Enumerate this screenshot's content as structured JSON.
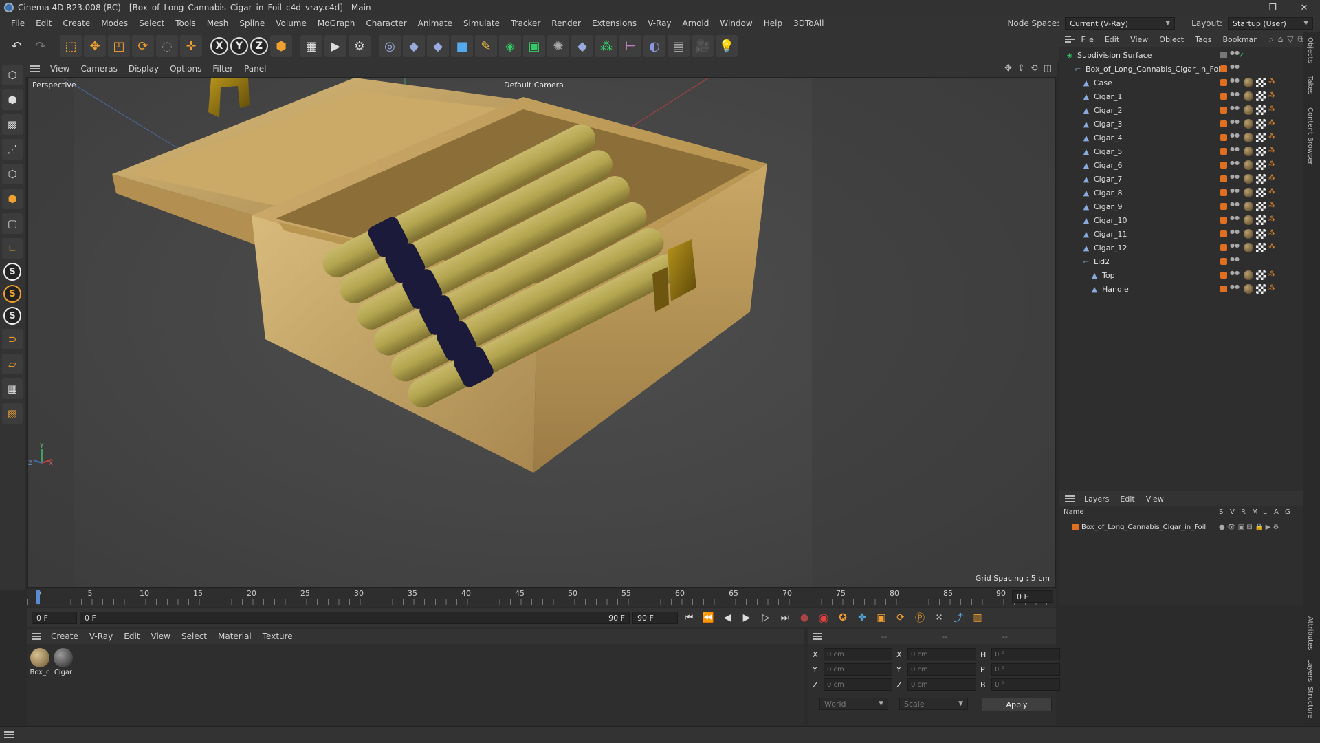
{
  "window": {
    "title": "Cinema 4D R23.008 (RC) - [Box_of_Long_Cannabis_Cigar_in_Foil_c4d_vray.c4d] - Main"
  },
  "menubar": {
    "items": [
      "File",
      "Edit",
      "Create",
      "Modes",
      "Select",
      "Tools",
      "Mesh",
      "Spline",
      "Volume",
      "MoGraph",
      "Character",
      "Animate",
      "Simulate",
      "Tracker",
      "Render",
      "Extensions",
      "V-Ray",
      "Arnold",
      "Window",
      "Help",
      "3DToAll"
    ],
    "node_space_label": "Node Space:",
    "node_space_value": "Current (V-Ray)",
    "layout_label": "Layout:",
    "layout_value": "Startup (User)"
  },
  "viewport": {
    "menu": [
      "View",
      "Cameras",
      "Display",
      "Options",
      "Filter",
      "Panel"
    ],
    "label": "Perspective",
    "camera": "Default Camera",
    "grid_spacing": "Grid Spacing : 5 cm"
  },
  "timeline": {
    "ticks": [
      "0",
      "5",
      "10",
      "15",
      "20",
      "25",
      "30",
      "35",
      "40",
      "45",
      "50",
      "55",
      "60",
      "65",
      "70",
      "75",
      "80",
      "85",
      "90"
    ],
    "current_frame": "0 F",
    "end_field": "0 F",
    "start": "0 F",
    "range_start": "0 F",
    "range_end": "90 F",
    "max_frame": "90 F"
  },
  "material_manager": {
    "menu": [
      "Create",
      "V-Ray",
      "Edit",
      "View",
      "Select",
      "Material",
      "Texture"
    ],
    "materials": [
      {
        "label": "Box_c",
        "color": "#a08858"
      },
      {
        "label": "Cigar",
        "color": "#5a5a5a"
      }
    ]
  },
  "coordinates": {
    "head": [
      "--",
      "--",
      "--"
    ],
    "rows": [
      {
        "a": "X",
        "av": "0 cm",
        "b": "X",
        "bv": "0 cm",
        "c": "H",
        "cv": "0 °"
      },
      {
        "a": "Y",
        "av": "0 cm",
        "b": "Y",
        "bv": "0 cm",
        "c": "P",
        "cv": "0 °"
      },
      {
        "a": "Z",
        "av": "0 cm",
        "b": "Z",
        "bv": "0 cm",
        "c": "B",
        "cv": "0 °"
      }
    ],
    "world": "World",
    "scale": "Scale",
    "apply": "Apply"
  },
  "object_manager": {
    "menu": [
      "File",
      "Edit",
      "View",
      "Object",
      "Tags",
      "Bookmar"
    ],
    "objects": [
      {
        "name": "Subdivision Surface",
        "indent": 0,
        "icon": "subdivision-icon",
        "tags": false
      },
      {
        "name": "Box_of_Long_Cannabis_Cigar_in_Foil",
        "indent": 1,
        "icon": "null-icon",
        "tags": false
      },
      {
        "name": "Case",
        "indent": 2,
        "icon": "polygon-icon",
        "tags": true
      },
      {
        "name": "Cigar_1",
        "indent": 2,
        "icon": "polygon-icon",
        "tags": true
      },
      {
        "name": "Cigar_2",
        "indent": 2,
        "icon": "polygon-icon",
        "tags": true
      },
      {
        "name": "Cigar_3",
        "indent": 2,
        "icon": "polygon-icon",
        "tags": true
      },
      {
        "name": "Cigar_4",
        "indent": 2,
        "icon": "polygon-icon",
        "tags": true
      },
      {
        "name": "Cigar_5",
        "indent": 2,
        "icon": "polygon-icon",
        "tags": true
      },
      {
        "name": "Cigar_6",
        "indent": 2,
        "icon": "polygon-icon",
        "tags": true
      },
      {
        "name": "Cigar_7",
        "indent": 2,
        "icon": "polygon-icon",
        "tags": true
      },
      {
        "name": "Cigar_8",
        "indent": 2,
        "icon": "polygon-icon",
        "tags": true
      },
      {
        "name": "Cigar_9",
        "indent": 2,
        "icon": "polygon-icon",
        "tags": true
      },
      {
        "name": "Cigar_10",
        "indent": 2,
        "icon": "polygon-icon",
        "tags": true
      },
      {
        "name": "Cigar_11",
        "indent": 2,
        "icon": "polygon-icon",
        "tags": true
      },
      {
        "name": "Cigar_12",
        "indent": 2,
        "icon": "polygon-icon",
        "tags": true
      },
      {
        "name": "Lid2",
        "indent": 2,
        "icon": "null-icon",
        "tags": false
      },
      {
        "name": "Top",
        "indent": 3,
        "icon": "polygon-icon",
        "tags": true
      },
      {
        "name": "Handle",
        "indent": 3,
        "icon": "polygon-icon",
        "tags": true
      }
    ]
  },
  "layers": {
    "menu": [
      "Layers",
      "Edit",
      "View"
    ],
    "columns": [
      "Name",
      "S",
      "V",
      "R",
      "M",
      "L",
      "A",
      "G"
    ],
    "row": "Box_of_Long_Cannabis_Cigar_in_Foil"
  },
  "side_tabs": [
    "Objects",
    "Takes",
    "Content Browser",
    "Attributes",
    "Layers",
    "Structure"
  ],
  "colors": {
    "accent_orange": "#e07020",
    "wood": "#c9a765"
  }
}
